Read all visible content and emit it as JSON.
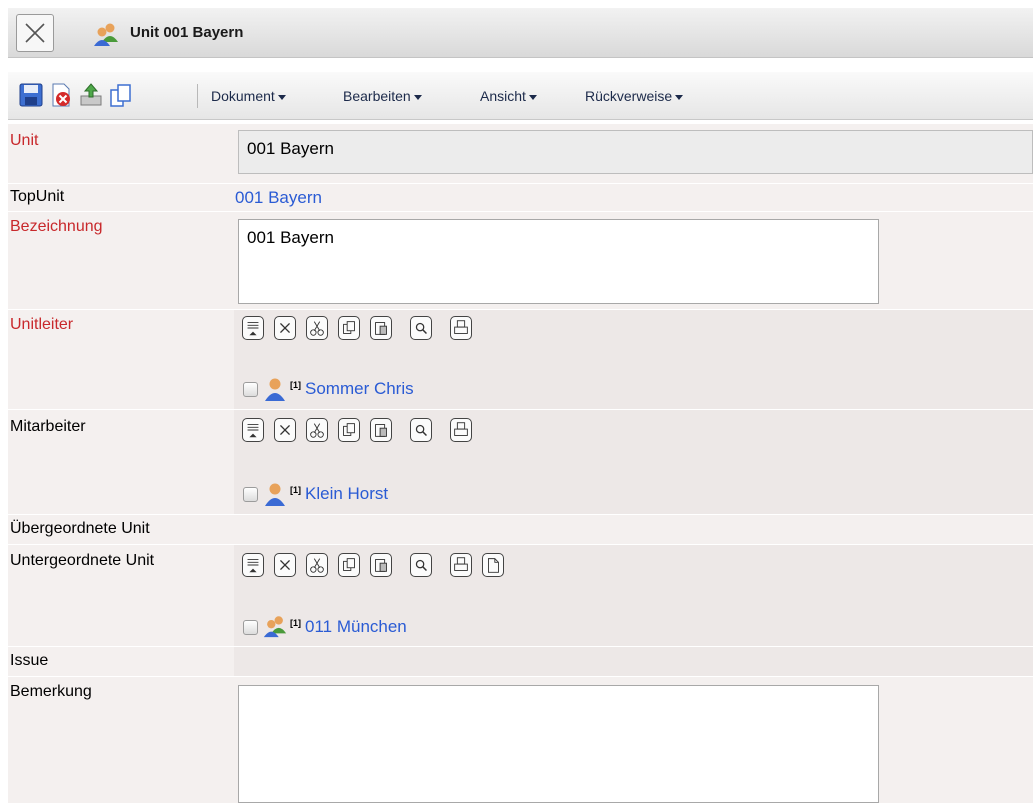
{
  "window": {
    "title": "Unit 001 Bayern",
    "close_icon": "close-x-icon",
    "unit_icon": "unit-people-icon"
  },
  "toolbar": {
    "icons": [
      "save-icon",
      "delete-icon",
      "upload-icon",
      "copy-icon"
    ],
    "menus": [
      "Dokument",
      "Bearbeiten",
      "Ansicht",
      "Rückverweise"
    ]
  },
  "form": {
    "unit": {
      "label": "Unit",
      "value": "001 Bayern"
    },
    "topunit": {
      "label": "TopUnit",
      "value": "001 Bayern"
    },
    "bezeichnung": {
      "label": "Bezeichnung",
      "value": "001 Bayern"
    },
    "unitleiter": {
      "label": "Unitleiter",
      "actions": [
        "select-list",
        "remove",
        "cut",
        "copy",
        "paste",
        "search",
        "print"
      ],
      "entry": {
        "marker": "[1]",
        "name": "Sommer Chris",
        "icon": "person-icon"
      }
    },
    "mitarbeiter": {
      "label": "Mitarbeiter",
      "actions": [
        "select-list",
        "remove",
        "cut",
        "copy",
        "paste",
        "search",
        "print"
      ],
      "entry": {
        "marker": "[1]",
        "name": "Klein Horst",
        "icon": "person-icon"
      }
    },
    "uebergeordnete": {
      "label": "Übergeordnete Unit"
    },
    "untergeordnete": {
      "label": "Untergeordnete Unit",
      "actions": [
        "select-list",
        "remove",
        "cut",
        "copy",
        "paste",
        "search",
        "print",
        "new-document"
      ],
      "entry": {
        "marker": "[1]",
        "name": "011 München",
        "icon": "unit-people-icon"
      }
    },
    "issue": {
      "label": "Issue"
    },
    "bemerkung": {
      "label": "Bemerkung",
      "value": ""
    }
  },
  "colors": {
    "required_label": "#c8282b",
    "link": "#2a5bd4",
    "row_bg": "#f4f0ef"
  }
}
